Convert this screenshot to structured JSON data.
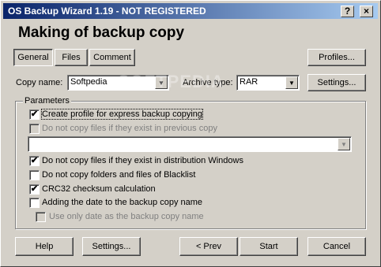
{
  "window": {
    "title": "OS Backup Wizard 1.19 - NOT REGISTERED"
  },
  "titlebar_buttons": {
    "help": "?",
    "close": "×"
  },
  "heading": "Making of backup copy",
  "tabs": [
    "General",
    "Files",
    "Comment"
  ],
  "buttons": {
    "profiles": "Profiles...",
    "settings_top": "Settings...",
    "help": "Help",
    "settings_bottom": "Settings...",
    "prev": "< Prev",
    "start": "Start",
    "cancel": "Cancel"
  },
  "copy_name": {
    "label": "Copy name:",
    "value": "Softpedia"
  },
  "archive_type": {
    "label": "Archive type:",
    "value": "RAR"
  },
  "watermark": "SOFTPEDIA",
  "parameters": {
    "title": "Parameters",
    "options": [
      {
        "label": "Create profile for express backup copying",
        "checked": true,
        "enabled": true
      },
      {
        "label": "Do not copy files if they exist in previous copy",
        "checked": false,
        "enabled": false
      },
      {
        "label": "Do not copy files if they exist in distribution Windows",
        "checked": true,
        "enabled": true
      },
      {
        "label": "Do not copy folders and files of Blacklist",
        "checked": false,
        "enabled": true
      },
      {
        "label": "CRC32 checksum calculation",
        "checked": true,
        "enabled": true
      },
      {
        "label": "Adding the date to the backup copy name",
        "checked": false,
        "enabled": true
      },
      {
        "label": "Use only date as the backup copy name",
        "checked": false,
        "enabled": false
      }
    ],
    "previous_copy_dropdown": {
      "value": ""
    }
  }
}
